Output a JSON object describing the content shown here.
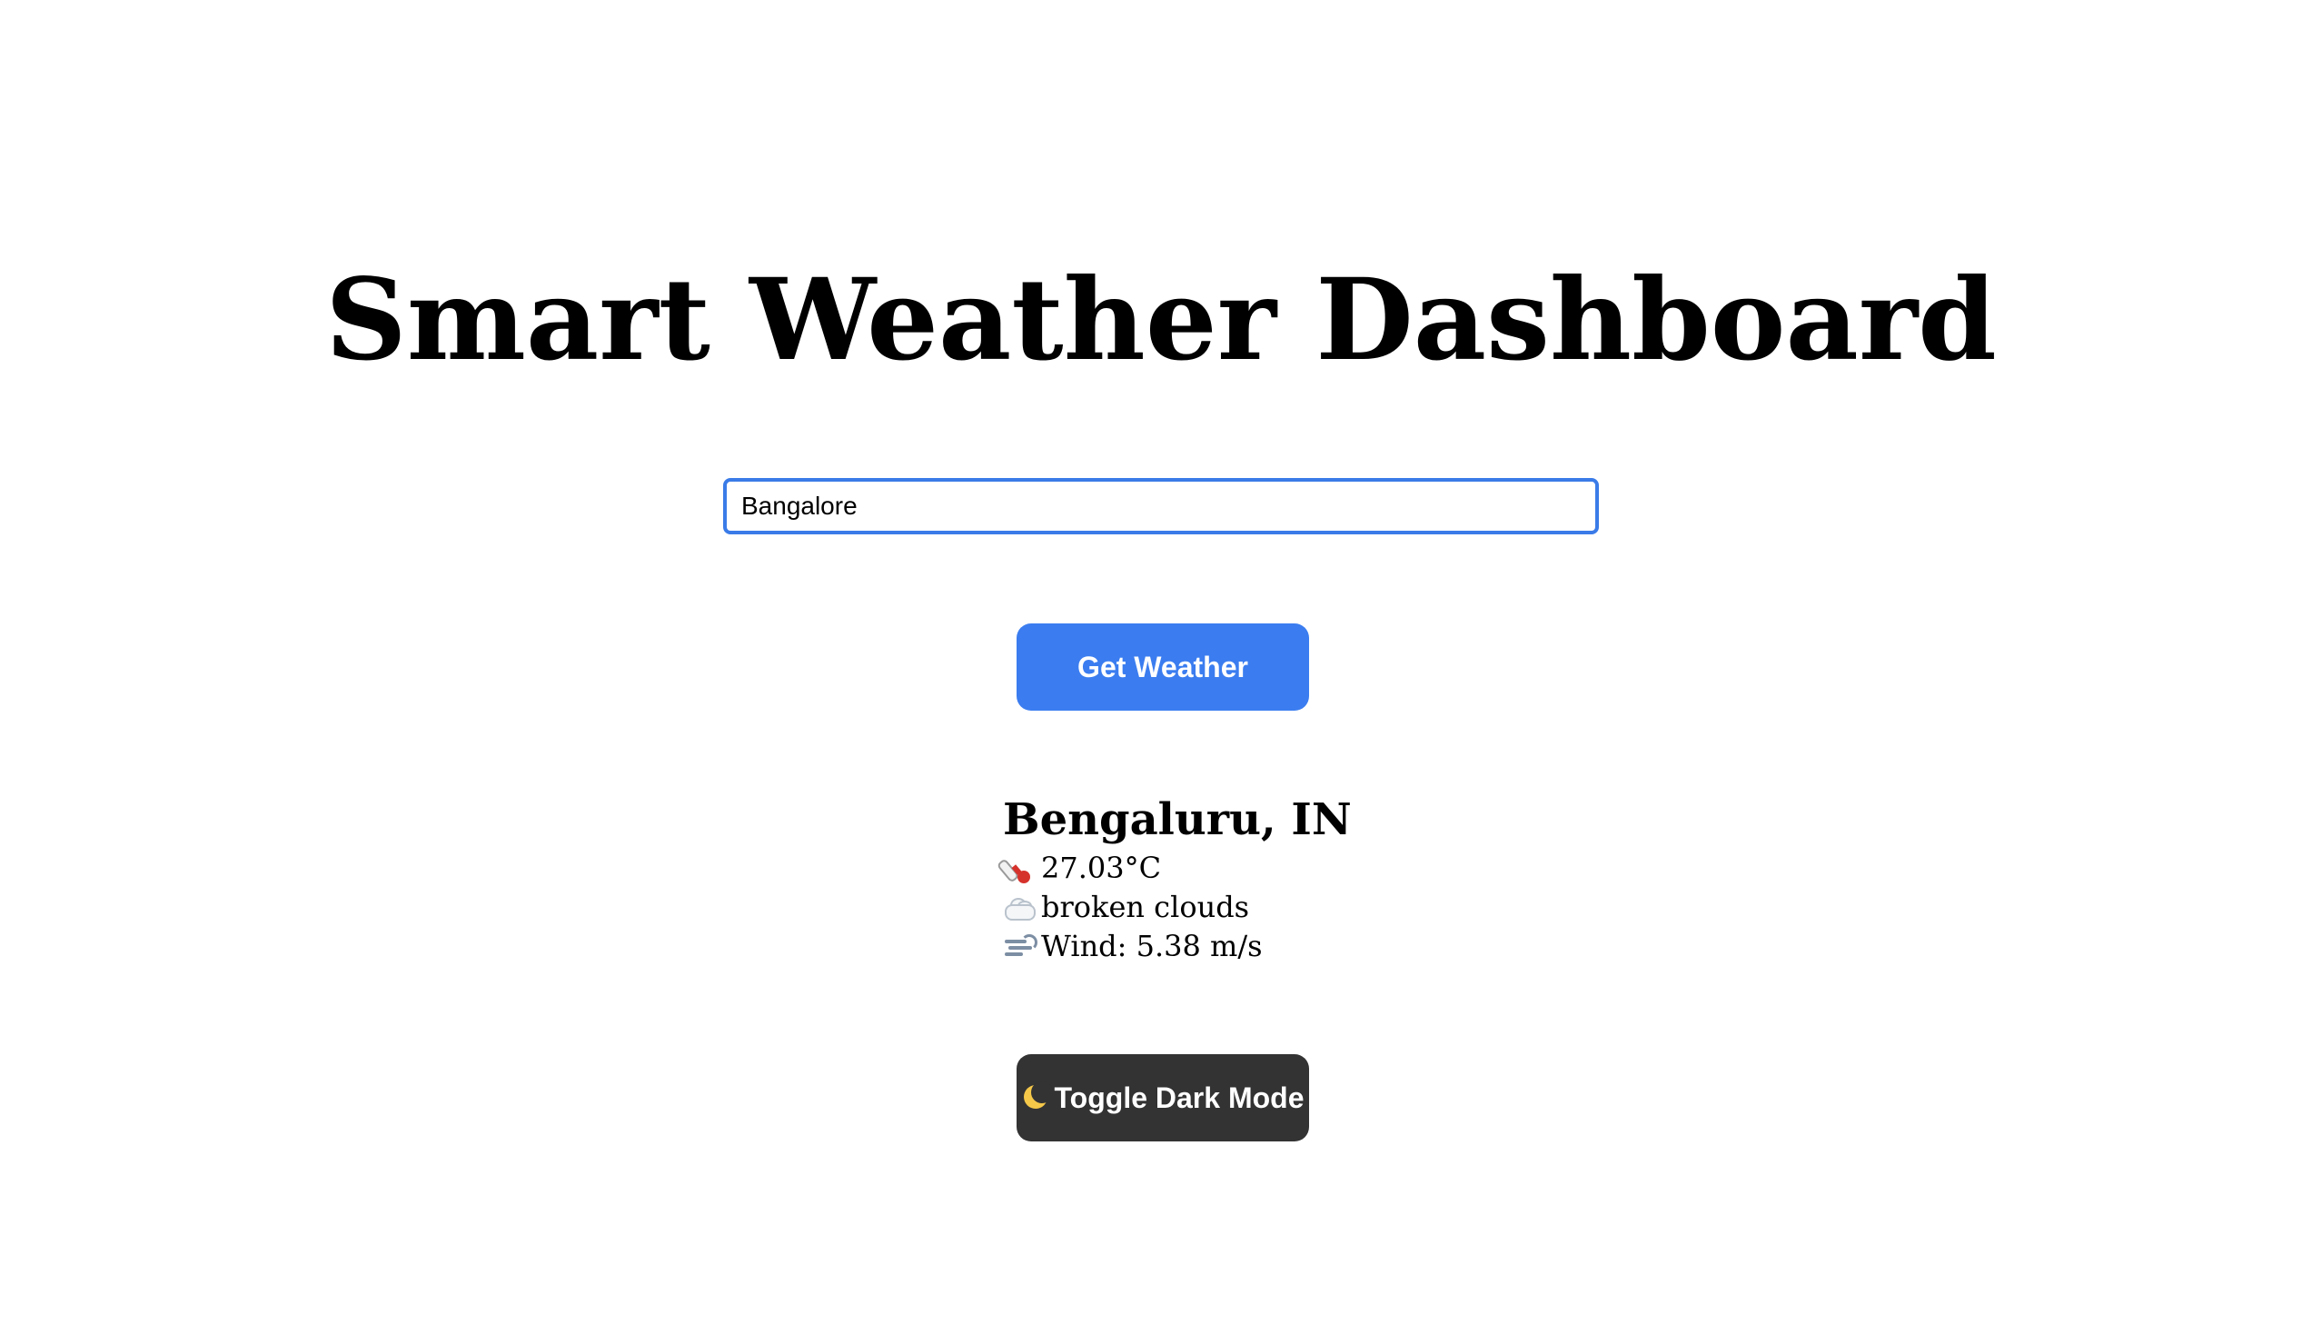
{
  "header": {
    "title": "Smart Weather Dashboard"
  },
  "search": {
    "value": "Bangalore",
    "button_label": "Get Weather"
  },
  "weather": {
    "location": "Bengaluru, IN",
    "temperature": "27.03°C",
    "description": "broken clouds",
    "wind": "Wind: 5.38 m/s",
    "icons": {
      "temperature": "thermometer-icon",
      "description": "cloud-icon",
      "wind": "wind-icon"
    }
  },
  "theme_toggle": {
    "label": "Toggle Dark Mode",
    "icon": "moon-icon"
  },
  "colors": {
    "primary_button": "#3b7df0",
    "input_border": "#3a7be8",
    "dark_button": "#333333",
    "background": "#ffffff"
  }
}
